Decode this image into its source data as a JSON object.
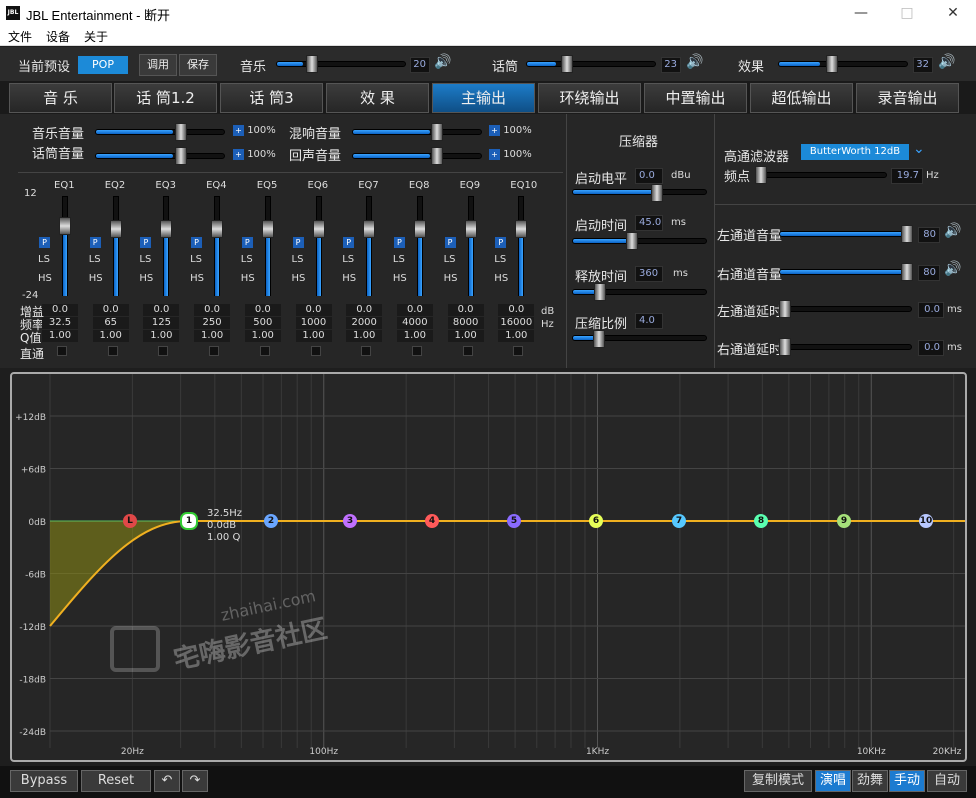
{
  "window": {
    "title": "JBL Entertainment - 断开",
    "logo_text": "JBL"
  },
  "menu": [
    "文件",
    "设备",
    "关于"
  ],
  "preset": {
    "label": "当前预设",
    "value": "POP",
    "tune_btn": "调用",
    "save_btn": "保存"
  },
  "top_sliders": [
    {
      "label": "音乐",
      "value": "20",
      "level": 0.2
    },
    {
      "label": "话筒",
      "value": "23",
      "level": 0.23
    },
    {
      "label": "效果",
      "value": "32",
      "level": 0.32
    }
  ],
  "tabs": [
    "音 乐",
    "话 筒1.2",
    "话 筒3",
    "效 果",
    "主输出",
    "环绕输出",
    "中置输出",
    "超低输出",
    "录音输出"
  ],
  "active_tab": 4,
  "volumes": [
    {
      "label": "音乐音量",
      "value": "100%",
      "level": 0.6
    },
    {
      "label": "话筒音量",
      "value": "100%",
      "level": 0.6
    },
    {
      "label": "混响音量",
      "value": "100%",
      "level": 0.6
    },
    {
      "label": "回声音量",
      "value": "100%",
      "level": 0.6
    }
  ],
  "eq": {
    "scale_top": "12",
    "scale_bottom": "-24",
    "row_labels": {
      "gain": "增益",
      "freq": "频率",
      "q": "Q值",
      "direct": "直通"
    },
    "units": {
      "db": "dB",
      "hz": "Hz"
    },
    "p_label": "P",
    "ls_label": "LS",
    "hs_label": "HS",
    "bands": [
      {
        "name": "EQ1",
        "gain": "0.0",
        "freq": "32.5",
        "q": "1.00"
      },
      {
        "name": "EQ2",
        "gain": "0.0",
        "freq": "65",
        "q": "1.00"
      },
      {
        "name": "EQ3",
        "gain": "0.0",
        "freq": "125",
        "q": "1.00"
      },
      {
        "name": "EQ4",
        "gain": "0.0",
        "freq": "250",
        "q": "1.00"
      },
      {
        "name": "EQ5",
        "gain": "0.0",
        "freq": "500",
        "q": "1.00"
      },
      {
        "name": "EQ6",
        "gain": "0.0",
        "freq": "1000",
        "q": "1.00"
      },
      {
        "name": "EQ7",
        "gain": "0.0",
        "freq": "2000",
        "q": "1.00"
      },
      {
        "name": "EQ8",
        "gain": "0.0",
        "freq": "4000",
        "q": "1.00"
      },
      {
        "name": "EQ9",
        "gain": "0.0",
        "freq": "8000",
        "q": "1.00"
      },
      {
        "name": "EQ10",
        "gain": "0.0",
        "freq": "16000",
        "q": "1.00"
      }
    ]
  },
  "compressor": {
    "title": "压缩器",
    "threshold": {
      "label": "启动电平",
      "value": "0.0",
      "unit": "dBu",
      "level": 0.6
    },
    "attack": {
      "label": "启动时间",
      "value": "45.0",
      "unit": "ms",
      "level": 0.45
    },
    "release": {
      "label": "释放时间",
      "value": "360",
      "unit": "ms",
      "level": 0.2
    },
    "ratio": {
      "label": "压缩比例",
      "value": "4.0",
      "level": 0.2
    }
  },
  "highpass": {
    "label": "高通滤波器",
    "type": "ButterWorth 12dB",
    "freq_label": "频点",
    "freq_value": "19.7",
    "freq_unit": "Hz"
  },
  "outputs": [
    {
      "label": "左通道音量",
      "value": "80",
      "level": 0.95
    },
    {
      "label": "右通道音量",
      "value": "80",
      "level": 0.95
    },
    {
      "label": "左通道延时",
      "value": "0.0",
      "unit": "ms",
      "level": 0.0
    },
    {
      "label": "右通道延时",
      "value": "0.0",
      "unit": "ms",
      "level": 0.0
    }
  ],
  "graph": {
    "y_labels": [
      "+12dB",
      "+6dB",
      "0dB",
      "-6dB",
      "-12dB",
      "-18dB",
      "-24dB"
    ],
    "x_labels": [
      "20Hz",
      "100Hz",
      "1KHz",
      "10KHz",
      "20KHz"
    ],
    "nodes": [
      "L",
      "1",
      "2",
      "3",
      "4",
      "5",
      "6",
      "7",
      "8",
      "9",
      "10"
    ],
    "node_colors": [
      "#e04848",
      "#ffffff",
      "#6aa6ff",
      "#c070ff",
      "#ff5a5a",
      "#8a6bff",
      "#e6ff58",
      "#56c8ff",
      "#5affb0",
      "#a6e07a",
      "#b8c8ff"
    ],
    "tooltip": [
      "32.5Hz",
      "0.0dB",
      "1.00 Q"
    ],
    "watermark_url": "zhaihai.com",
    "watermark_name": "宅嗨影音社区"
  },
  "bottom": {
    "bypass": "Bypass",
    "reset": "Reset",
    "copy_mode": "复制模式",
    "modes": [
      "演唱",
      "劲舞",
      "手动",
      "自动"
    ],
    "active_modes": [
      0,
      2
    ]
  }
}
